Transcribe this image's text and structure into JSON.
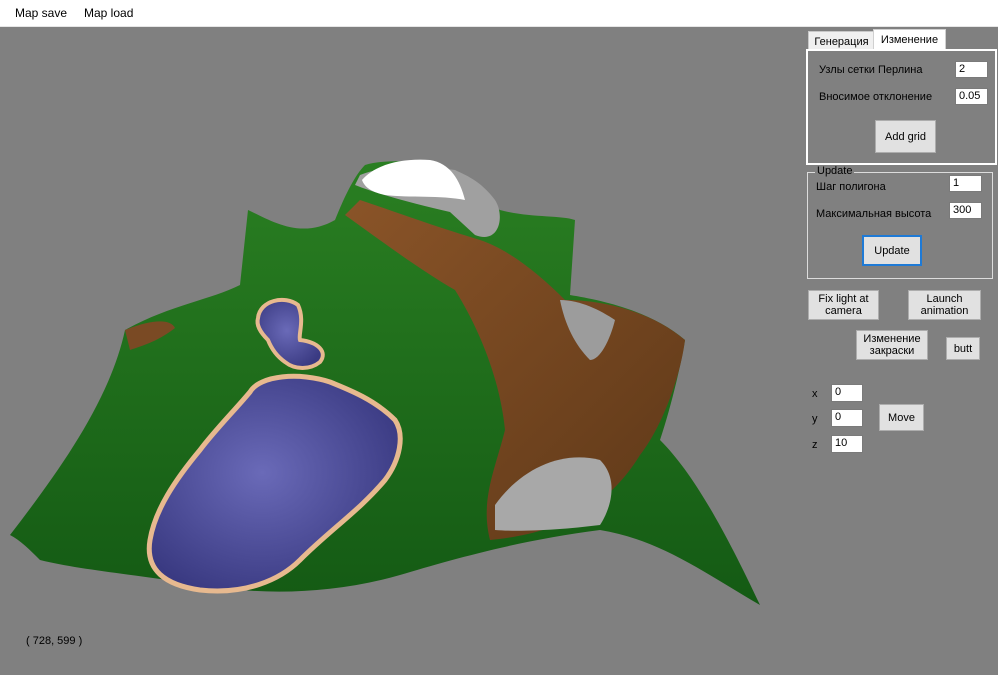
{
  "menu": {
    "items": [
      "Map save",
      "Map load"
    ]
  },
  "viewport": {
    "coords": "( 728, 599 )"
  },
  "tabs": [
    "Генерация",
    "Изменение"
  ],
  "change_tab": {
    "perlin_nodes": {
      "label": "Узлы сетки Перлина",
      "value": "2"
    },
    "deviation": {
      "label": "Вносимое отклонение",
      "value": "0.05"
    },
    "add_grid": "Add grid"
  },
  "update_group": {
    "title": "Update",
    "polygon_step": {
      "label": "Шаг полигона",
      "value": "1"
    },
    "max_height": {
      "label": "Максимальная высота",
      "value": "300"
    },
    "update_button": "Update"
  },
  "buttons": {
    "fix_light": "Fix light at camera",
    "launch_animation": "Launch animation",
    "change_coloring": "Изменение закраски",
    "butt": "butt"
  },
  "position": {
    "x_label": "x",
    "x_value": "0",
    "y_label": "y",
    "y_value": "0",
    "z_label": "z",
    "z_value": "10",
    "move": "Move"
  },
  "colors": {
    "background": "#808080",
    "grass": "#1f6b1c",
    "dirt": "#7a4a24",
    "rock": "#9a9a9a",
    "snow": "#ffffff",
    "water": "#4e4e96",
    "sand": "#e7b98f"
  }
}
